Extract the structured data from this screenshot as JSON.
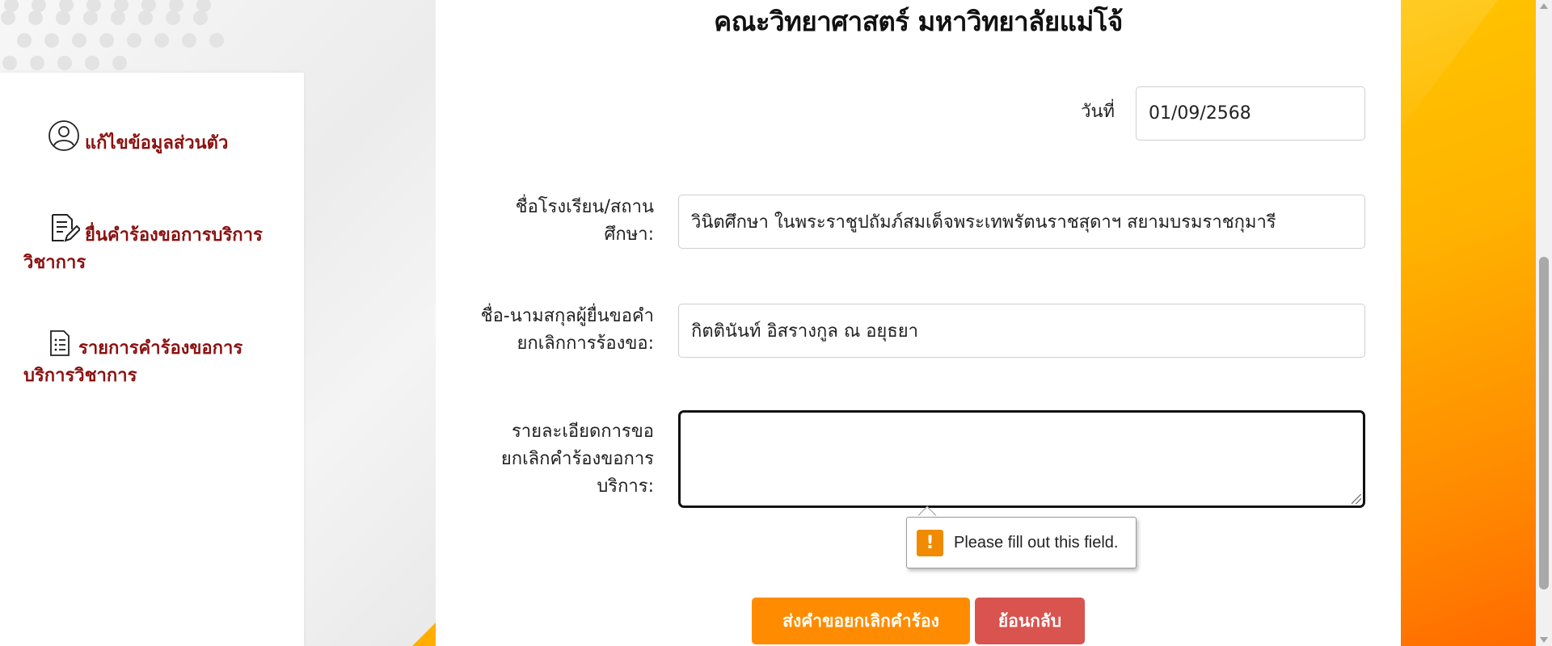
{
  "page": {
    "title": "คณะวิทยาศาสตร์ มหาวิทยาลัยแม่โจ้"
  },
  "sidebar": {
    "items": [
      {
        "label": "แก้ไขข้อมูลส่วนตัว",
        "icon": "user-circle-icon"
      },
      {
        "label": "ยื่นคำร้องขอการบริการวิชาการ",
        "icon": "edit-document-icon"
      },
      {
        "label": "รายการคำร้องขอการบริการวิชาการ",
        "icon": "list-document-icon"
      }
    ]
  },
  "form": {
    "date_label": "วันที่",
    "date_value": "01/09/2568",
    "school_label": "ชื่อโรงเรียน/สถานศึกษา:",
    "school_value": "วินิตศึกษา ในพระราชูปถัมภ์สมเด็จพระเทพรัตนราชสุดาฯ สยามบรมราชกุมารี",
    "name_label": "ชื่อ-นามสกุลผู้ยื่นขอคำยกเลิกการร้องขอ:",
    "name_value": "กิตตินันท์ อิสรางกูล ณ อยุธยา",
    "detail_label": "รายละเอียดการขอยกเลิกคำร้องขอการบริการ:",
    "detail_value": ""
  },
  "validation": {
    "message": "Please fill out this field.",
    "icon_glyph": "!"
  },
  "buttons": {
    "submit": "ส่งคำขอยกเลิกคำร้อง",
    "back": "ย้อนกลับ"
  },
  "colors": {
    "sidebar_text": "#8b1010",
    "submit_button": "#ff8c00",
    "back_button": "#d9534f",
    "accent_orange": "#ffb300"
  }
}
